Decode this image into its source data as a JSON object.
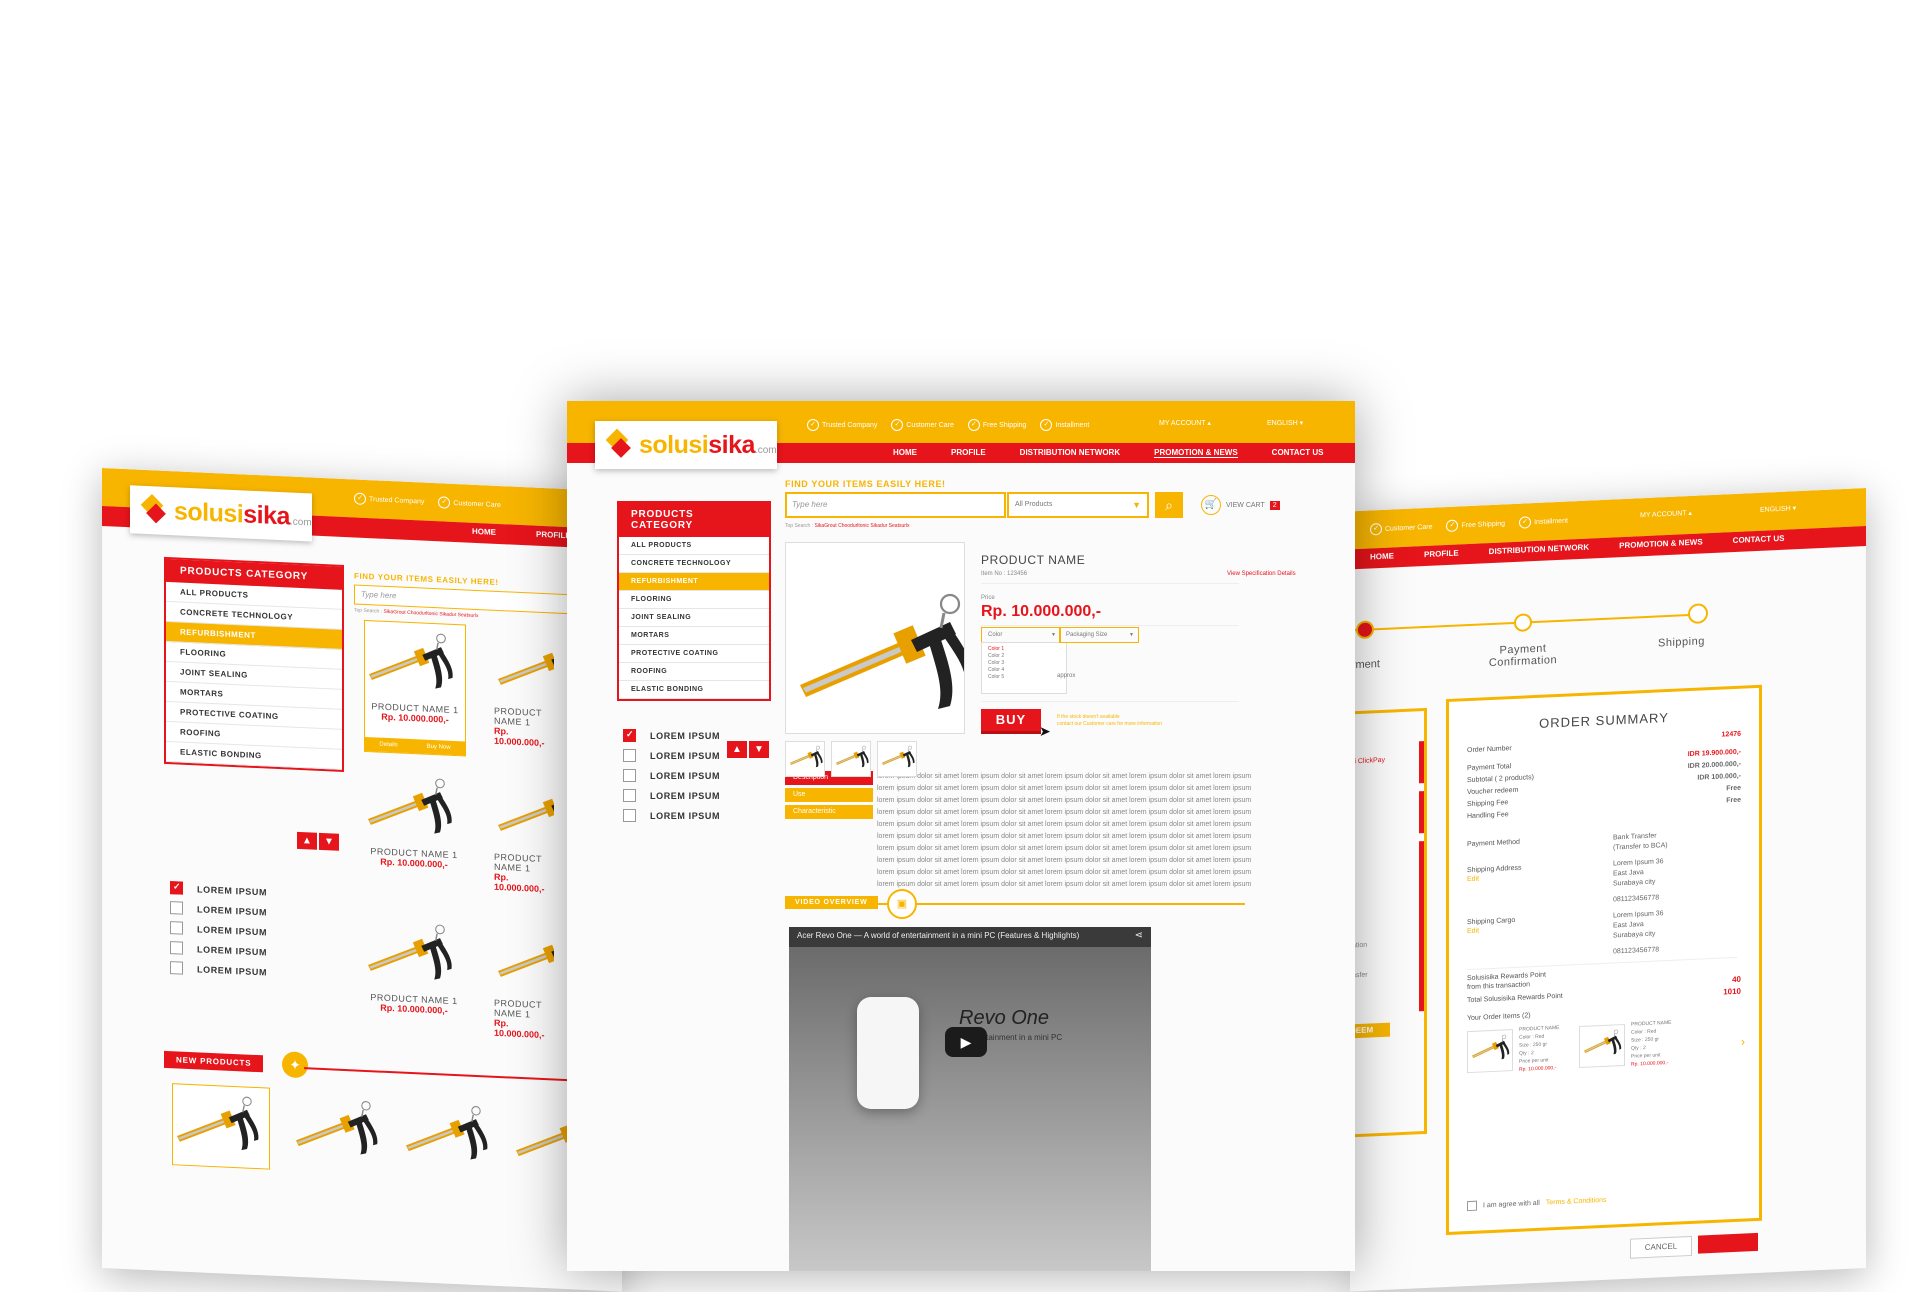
{
  "brand": {
    "name_a": "solusi",
    "name_b": "sika",
    "suffix": ".com"
  },
  "topbar": {
    "features": [
      "Trusted Company",
      "Customer Care",
      "Free Shipping",
      "Installment"
    ],
    "account": "MY ACCOUNT ▴",
    "language": "ENGLISH ▾"
  },
  "nav": [
    "HOME",
    "PROFILE",
    "DISTRIBUTION NETWORK",
    "PROMOTION & NEWS",
    "CONTACT US"
  ],
  "left_nav": [
    "HOME",
    "PROFILE"
  ],
  "right_nav": [
    "HOME",
    "PROFILE",
    "DISTRIBUTION NETWORK",
    "PROMOTION & NEWS",
    "CONTACT US"
  ],
  "right_features": [
    "Customer Care",
    "Free Shipping",
    "Installment"
  ],
  "categories": {
    "title": "PRODUCTS CATEGORY",
    "items": [
      "ALL PRODUCTS",
      "CONCRETE TECHNOLOGY",
      "REFURBISHMENT",
      "FLOORING",
      "JOINT SEALING",
      "MORTARS",
      "PROTECTIVE COATING",
      "ROOFING",
      "ELASTIC BONDING"
    ],
    "selected": "REFURBISHMENT"
  },
  "filters": [
    "LOREM IPSUM",
    "LOREM IPSUM",
    "LOREM IPSUM",
    "LOREM IPSUM",
    "LOREM IPSUM"
  ],
  "search": {
    "label": "FIND YOUR ITEMS EASILY HERE!",
    "placeholder": "Type here",
    "select": "All Products",
    "top_label": "Top Search :",
    "top_terms": "SikaGrout  Choodurltonic  Sikadur  Seatsurlx",
    "cart_label": "VIEW CART",
    "cart_count": "2"
  },
  "product": {
    "name": "PRODUCT NAME",
    "item_no": "Item No : 123456",
    "spec_link": "View Specification Details",
    "price_label": "Price",
    "price": "Rp. 10.000.000,-",
    "color_label": "Color",
    "colors": [
      "Color 1",
      "Color 2",
      "Color 3",
      "Color 4",
      "Color 5"
    ],
    "packaging_label": "Packaging Size",
    "approx": "approx",
    "buy": "BUY",
    "stock_note_1": "If the stock doesn't available",
    "stock_note_2": "contact our Customer care for more information"
  },
  "tabs": [
    "Description",
    "Use",
    "Characteristic"
  ],
  "description_lines": [
    "lorem ipsum dolor sit amet lorem ipsum dolor sit amet lorem ipsum dolor sit amet lorem ipsum dolor sit amet lorem ipsum",
    "lorem ipsum dolor sit amet lorem ipsum dolor sit amet lorem ipsum dolor sit amet lorem ipsum dolor sit amet lorem ipsum",
    "lorem ipsum dolor sit amet lorem ipsum dolor sit amet lorem ipsum dolor sit amet lorem ipsum dolor sit amet lorem ipsum",
    "lorem ipsum dolor sit amet lorem ipsum dolor sit amet lorem ipsum dolor sit amet lorem ipsum dolor sit amet lorem ipsum",
    "lorem ipsum dolor sit amet lorem ipsum dolor sit amet lorem ipsum dolor sit amet lorem ipsum dolor sit amet lorem ipsum",
    "lorem ipsum dolor sit amet lorem ipsum dolor sit amet lorem ipsum dolor sit amet lorem ipsum dolor sit amet lorem ipsum",
    "lorem ipsum dolor sit amet lorem ipsum dolor sit amet lorem ipsum dolor sit amet lorem ipsum dolor sit amet lorem ipsum",
    "lorem ipsum dolor sit amet lorem ipsum dolor sit amet lorem ipsum dolor sit amet lorem ipsum dolor sit amet lorem ipsum",
    "lorem ipsum dolor sit amet lorem ipsum dolor sit amet lorem ipsum dolor sit amet lorem ipsum dolor sit amet lorem ipsum",
    "lorem ipsum dolor sit amet lorem ipsum dolor sit amet lorem ipsum dolor sit amet lorem ipsum dolor sit amet lorem ipsum"
  ],
  "video": {
    "section_label": "VIDEO OVERVIEW",
    "title": "Acer Revo One — A world of entertainment in a mini PC (Features & Highlights)",
    "overlay_a": "Revo One",
    "overlay_b": "of entertainment in a mini PC"
  },
  "listing": {
    "product_name": "PRODUCT NAME 1",
    "product_price": "Rp. 10.000.000,-",
    "details": "Details",
    "buy_now": "Buy Now",
    "new_products": "NEW PRODUCTS"
  },
  "checkout": {
    "steps": [
      "Payment Confirmation",
      "Shipping"
    ],
    "step_partial": "yment",
    "summary_title": "ORDER SUMMARY",
    "order_number_label": "Order Number",
    "order_number": "12476",
    "payment_total_label": "Payment Total",
    "payment_total": "IDR 19.900.000,-",
    "subtotal_label": "Subtotal ( 2 products)",
    "subtotal": "IDR 20.000.000,-",
    "voucher_label": "Voucher redeem",
    "voucher": "IDR 100.000,-",
    "shipping_fee_label": "Shipping Fee",
    "shipping_fee": "Free",
    "handling_fee_label": "Handling Fee",
    "handling_fee": "Free",
    "payment_method_label": "Payment Method",
    "payment_method": "Bank Transfer",
    "payment_method_2": "(Transfer to BCA)",
    "shipping_address_label": "Shipping Address",
    "edit": "Edit",
    "address_1": "Lorem Ipsum 36",
    "address_2": "East Java",
    "address_3": "Surabaya city",
    "phone": "081123456778",
    "shipping_cargo_label": "Shipping Cargo",
    "rewards_label_1": "Solusisika Rewards Point",
    "rewards_label_2": "from this transaction",
    "rewards_points": "40",
    "total_rewards_label": "Total Solusisika Rewards Point",
    "total_rewards": "1010",
    "your_items_label": "Your Order Items  (2)",
    "item_name": "PRODUCT NAME",
    "item_color": "Color : Red",
    "item_size": "Size   : 250 gr",
    "item_qty": "Qty    : 2",
    "item_price_label": "Price per unit",
    "item_price": "Rp. 10.000.000,-",
    "agree_text": "I am agree with all",
    "terms": "Terms & Conditions",
    "cancel": "CANCEL",
    "clickpay": "ri ClickPay",
    "partial_1": "ation",
    "partial_2": "nsfer",
    "partial_3": "DEEM"
  },
  "colors": {
    "yellow": "#f7b500",
    "red": "#e6141b"
  }
}
